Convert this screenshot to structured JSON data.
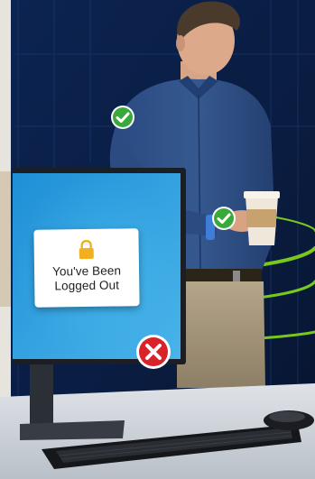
{
  "screen_notice": {
    "message": "You've Been\nLogged Out",
    "icon": "lock-icon"
  },
  "badges": [
    {
      "name": "check-badge-shoulder",
      "icon": "checkmark-icon",
      "color": "#3aa83a"
    },
    {
      "name": "check-badge-wrist",
      "icon": "checkmark-icon",
      "color": "#3aa83a"
    },
    {
      "name": "x-badge-monitor",
      "icon": "close-x-icon",
      "color": "#d8232a"
    }
  ],
  "colors": {
    "screen_blue": "#2e9ad8",
    "signal_green": "#7ed21c",
    "shirt_blue": "#2e4f86",
    "background_navy": "#0b1f4a",
    "lock_yellow": "#f2b01e"
  }
}
